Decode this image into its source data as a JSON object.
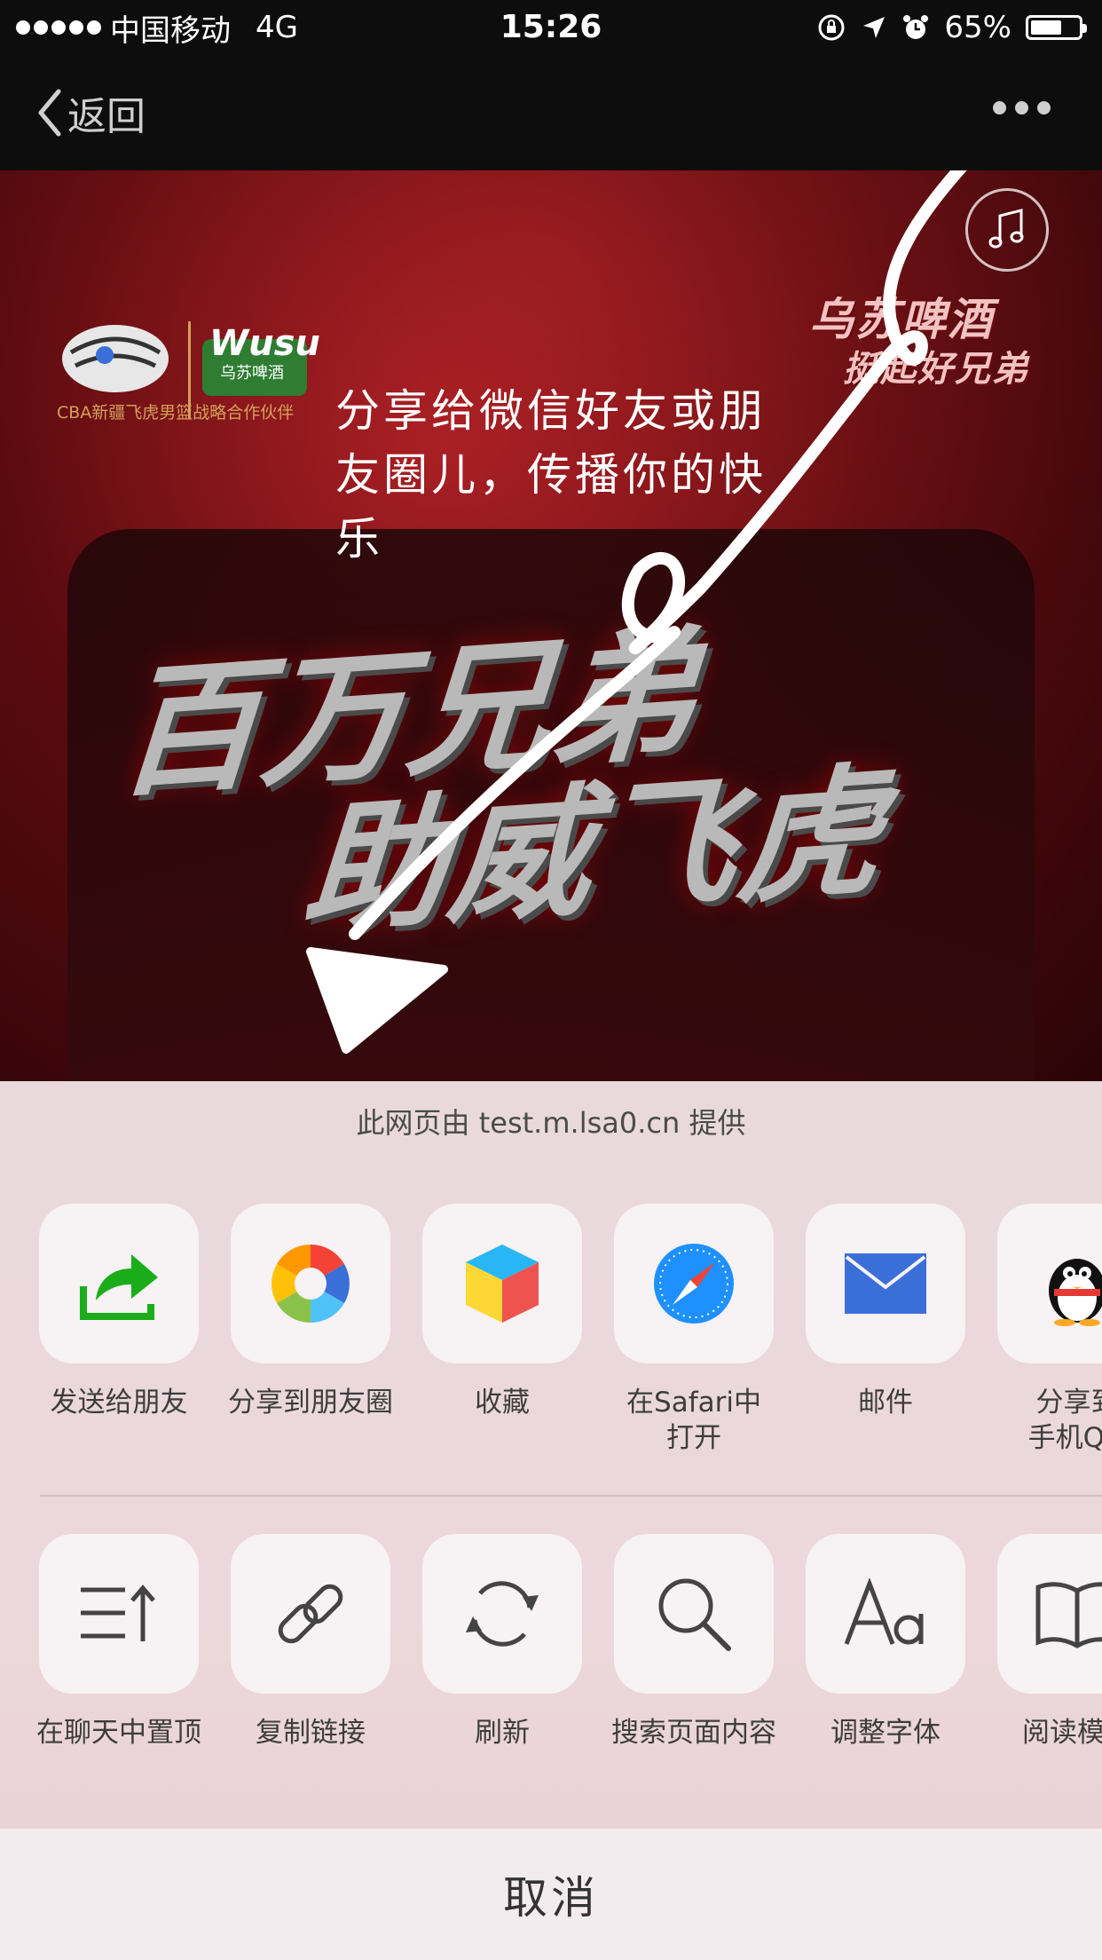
{
  "status_bar": {
    "carrier": "中国移动",
    "network": "4G",
    "time": "15:26",
    "battery_text": "65%",
    "battery_level": 0.65
  },
  "nav": {
    "back_label": "返回"
  },
  "web": {
    "logo_caption": "CBA新疆飞虎男篮战略合作伙伴",
    "logo_brand": "Wusu",
    "logo_brand_cn": "乌苏啤酒",
    "logo_right_line1": "乌苏啤酒",
    "logo_right_line2": "挺起好兄弟",
    "hint": "分享给微信好友或朋友圈儿，传播你的快乐",
    "title_line1": "百万兄弟",
    "title_line2": "助威飞虎"
  },
  "sheet": {
    "provider": "此网页由 test.m.lsa0.cn 提供",
    "row1": [
      {
        "label": "发送给朋友",
        "icon": "send-to-friend-icon"
      },
      {
        "label": "分享到朋友圈",
        "icon": "moments-icon"
      },
      {
        "label": "收藏",
        "icon": "favorites-cube-icon"
      },
      {
        "label": "在Safari中\n打开",
        "icon": "safari-compass-icon"
      },
      {
        "label": "邮件",
        "icon": "mail-icon"
      },
      {
        "label": "分享到\n手机QQ",
        "icon": "qq-penguin-icon"
      }
    ],
    "row2": [
      {
        "label": "在聊天中置顶",
        "icon": "pin-to-top-icon"
      },
      {
        "label": "复制链接",
        "icon": "link-icon"
      },
      {
        "label": "刷新",
        "icon": "refresh-icon"
      },
      {
        "label": "搜索页面内容",
        "icon": "search-icon"
      },
      {
        "label": "调整字体",
        "icon": "font-size-icon"
      },
      {
        "label": "阅读模式",
        "icon": "book-icon"
      }
    ],
    "cancel": "取消"
  },
  "colors": {
    "wechat_green": "#1aad19",
    "mail_blue": "#3a6fd8",
    "safari_blue": "#1e90ff"
  }
}
